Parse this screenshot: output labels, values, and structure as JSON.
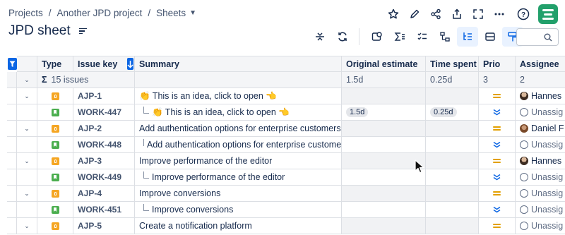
{
  "breadcrumb": {
    "projects": "Projects",
    "project": "Another JPD project",
    "sheets": "Sheets"
  },
  "page": {
    "title": "JPD sheet"
  },
  "table": {
    "headers": {
      "type": "Type",
      "key": "Issue key",
      "summary": "Summary",
      "estimate": "Original estimate",
      "spent": "Time spent",
      "prio": "Prio",
      "assignee": "Assignee"
    },
    "summary_row": {
      "sigma": "Σ",
      "count": "15 issues",
      "estimate": "1.5d",
      "spent": "0.25d",
      "prio": "3",
      "assignee": "2"
    },
    "rows": [
      {
        "key": "AJP-1",
        "summary": "👏 This is an idea, click to open 👈",
        "estimate": "",
        "spent": "",
        "assignee": "Hannes"
      },
      {
        "key": "WORK-447",
        "summary": "👏 This is an idea, click to open 👈",
        "estimate": "1.5d",
        "spent": "0.25d",
        "assignee": "Unassig"
      },
      {
        "key": "AJP-2",
        "summary": "Add authentication options for enterprise customers",
        "estimate": "",
        "spent": "",
        "assignee": "Daniel F"
      },
      {
        "key": "WORK-448",
        "summary": "Add authentication options for enterprise customers",
        "estimate": "",
        "spent": "",
        "assignee": "Unassig"
      },
      {
        "key": "AJP-3",
        "summary": "Improve performance of the editor",
        "estimate": "",
        "spent": "",
        "assignee": "Hannes"
      },
      {
        "key": "WORK-449",
        "summary": "Improve performance of the editor",
        "estimate": "",
        "spent": "",
        "assignee": "Unassig"
      },
      {
        "key": "AJP-4",
        "summary": "Improve conversions",
        "estimate": "",
        "spent": "",
        "assignee": "Unassig"
      },
      {
        "key": "WORK-451",
        "summary": "Improve conversions",
        "estimate": "",
        "spent": "",
        "assignee": "Unassig"
      },
      {
        "key": "AJP-5",
        "summary": "Create a notification platform",
        "estimate": "",
        "spent": "",
        "assignee": "Unassig"
      }
    ]
  },
  "colors": {
    "accent": "#0c66e4",
    "brand": "#22a06b",
    "idea": "#f5a623",
    "story": "#4bae4f",
    "prio_medium": "#e2a000",
    "prio_low": "#0c66e4"
  }
}
